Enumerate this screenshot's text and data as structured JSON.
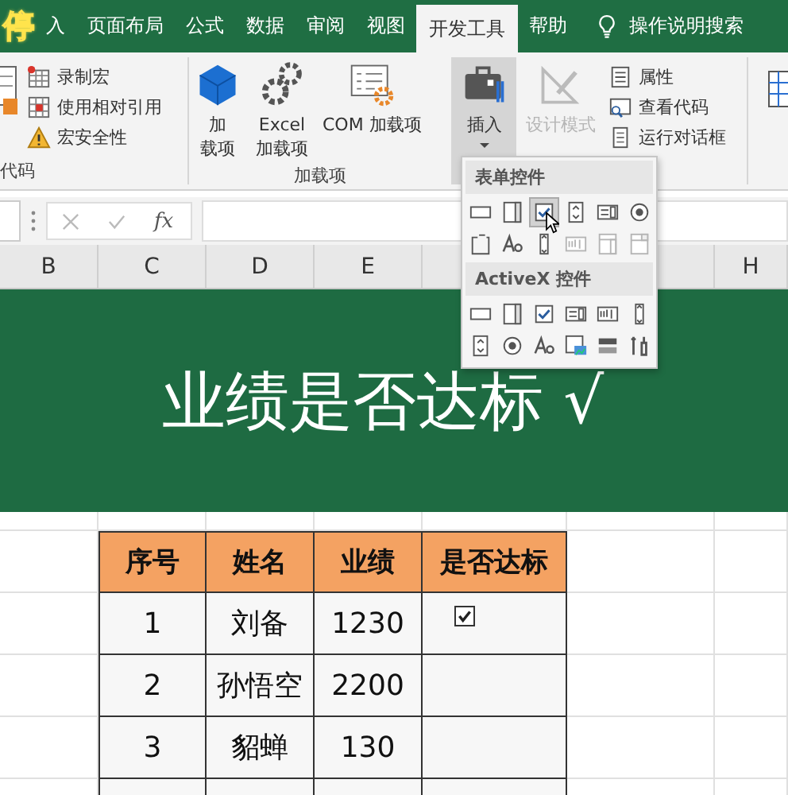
{
  "overlay_label": "停",
  "tabs": [
    {
      "label": "入",
      "selected": false
    },
    {
      "label": "页面布局",
      "selected": false
    },
    {
      "label": "公式",
      "selected": false
    },
    {
      "label": "数据",
      "selected": false
    },
    {
      "label": "审阅",
      "selected": false
    },
    {
      "label": "视图",
      "selected": false
    },
    {
      "label": "开发工具",
      "selected": true
    },
    {
      "label": "帮助",
      "selected": false
    }
  ],
  "tell_me": "操作说明搜索",
  "ribbon": {
    "code_group": {
      "label": "代码",
      "items": [
        {
          "kind": "record",
          "label": "录制宏"
        },
        {
          "kind": "relative",
          "label": "使用相对引用"
        },
        {
          "kind": "security",
          "label": "宏安全性"
        }
      ]
    },
    "addins_group": {
      "label": "加载项",
      "buttons": [
        {
          "kind": "cube",
          "lines": [
            "加",
            "载项"
          ]
        },
        {
          "kind": "gears",
          "lines": [
            "Excel",
            "加载项"
          ]
        },
        {
          "kind": "list",
          "lines": [
            "COM 加载项"
          ]
        }
      ]
    },
    "controls_group": {
      "insert": {
        "label": "插入",
        "pressed": true
      },
      "design": {
        "label": "设计模式",
        "disabled": true
      },
      "items": [
        {
          "kind": "properties",
          "label": "属性"
        },
        {
          "kind": "code",
          "label": "查看代码"
        },
        {
          "kind": "dialog",
          "label": "运行对话框"
        }
      ]
    }
  },
  "insert_menu": {
    "sections": [
      {
        "title": "表单控件",
        "controls": [
          {
            "kind": "button",
            "hovered": false,
            "disabled": false
          },
          {
            "kind": "combo",
            "hovered": false,
            "disabled": false
          },
          {
            "kind": "checkbox",
            "hovered": true,
            "disabled": false
          },
          {
            "kind": "spin",
            "hovered": false,
            "disabled": false
          },
          {
            "kind": "list",
            "hovered": false,
            "disabled": false
          },
          {
            "kind": "option",
            "hovered": false,
            "disabled": false
          },
          {
            "kind": "group",
            "hovered": false,
            "disabled": false
          },
          {
            "kind": "label",
            "hovered": false,
            "disabled": false
          },
          {
            "kind": "scroll",
            "hovered": false,
            "disabled": false
          },
          {
            "kind": "textfield",
            "hovered": false,
            "disabled": true
          },
          {
            "kind": "combolist",
            "hovered": false,
            "disabled": true
          },
          {
            "kind": "combodrop",
            "hovered": false,
            "disabled": true
          }
        ]
      },
      {
        "title": "ActiveX 控件",
        "controls": [
          {
            "kind": "button",
            "hovered": false,
            "disabled": false
          },
          {
            "kind": "combo",
            "hovered": false,
            "disabled": false
          },
          {
            "kind": "checkbox",
            "hovered": false,
            "disabled": false
          },
          {
            "kind": "list",
            "hovered": false,
            "disabled": false
          },
          {
            "kind": "textfield",
            "hovered": false,
            "disabled": false
          },
          {
            "kind": "scroll",
            "hovered": false,
            "disabled": false
          },
          {
            "kind": "spin",
            "hovered": false,
            "disabled": false
          },
          {
            "kind": "option",
            "hovered": false,
            "disabled": false
          },
          {
            "kind": "label",
            "hovered": false,
            "disabled": false
          },
          {
            "kind": "image",
            "hovered": false,
            "disabled": false
          },
          {
            "kind": "toggle",
            "hovered": false,
            "disabled": false
          },
          {
            "kind": "more",
            "hovered": false,
            "disabled": false
          }
        ]
      }
    ]
  },
  "formula_bar": {
    "function_label": "fx"
  },
  "column_headers": [
    "B",
    "C",
    "D",
    "E",
    "H"
  ],
  "banner": {
    "title": "业绩是否达标 √"
  },
  "table": {
    "columns": [
      "序号",
      "姓名",
      "业绩",
      "是否达标"
    ],
    "rows": [
      {
        "cells": [
          "1",
          "刘备",
          "1230"
        ],
        "checked": true
      },
      {
        "cells": [
          "2",
          "孙悟空",
          "2200"
        ]
      },
      {
        "cells": [
          "3",
          "貂蝉",
          "130"
        ]
      }
    ]
  }
}
